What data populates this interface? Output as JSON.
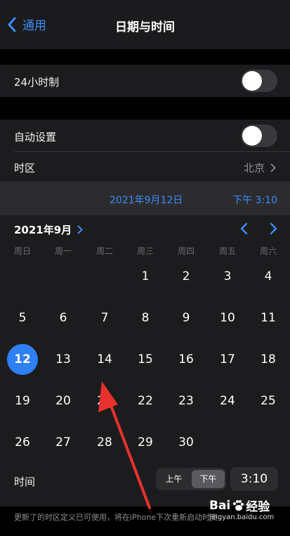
{
  "nav": {
    "back_label": "通用",
    "title": "日期与时间"
  },
  "settings": {
    "hour24_label": "24小时制",
    "hour24_on": false,
    "auto_label": "自动设置",
    "auto_on": false,
    "timezone_label": "时区",
    "timezone_value": "北京"
  },
  "datetime": {
    "date": "2021年9月12日",
    "time": "下午 3:10"
  },
  "calendar": {
    "month_label": "2021年9月",
    "weekdays": [
      "周日",
      "周一",
      "周二",
      "周三",
      "周四",
      "周五",
      "周六"
    ],
    "weeks": [
      [
        "",
        "",
        "",
        "1",
        "2",
        "3",
        "4"
      ],
      [
        "5",
        "6",
        "7",
        "8",
        "9",
        "10",
        "11"
      ],
      [
        "12",
        "13",
        "14",
        "15",
        "16",
        "17",
        "18"
      ],
      [
        "19",
        "20",
        "21",
        "22",
        "23",
        "24",
        "25"
      ],
      [
        "26",
        "27",
        "28",
        "29",
        "30",
        "",
        ""
      ]
    ],
    "selected_day": "12"
  },
  "time_picker": {
    "label": "时间",
    "am": "上午",
    "pm": "下午",
    "value": "3:10"
  },
  "footnote": "更新了的时区定义已可使用，将在iPhone下次重新启动时安装。",
  "watermark": {
    "brand_left": "Bai",
    "brand_right": "经验",
    "site": "jingyan.baidu.com"
  },
  "colors": {
    "accent": "#3d8bf7",
    "selected": "#2f7ff5",
    "annotation_arrow": "#e8312f"
  },
  "icons": [
    "chevron-left-icon",
    "chevron-right-icon",
    "paw-icon",
    "annotation-arrow"
  ]
}
